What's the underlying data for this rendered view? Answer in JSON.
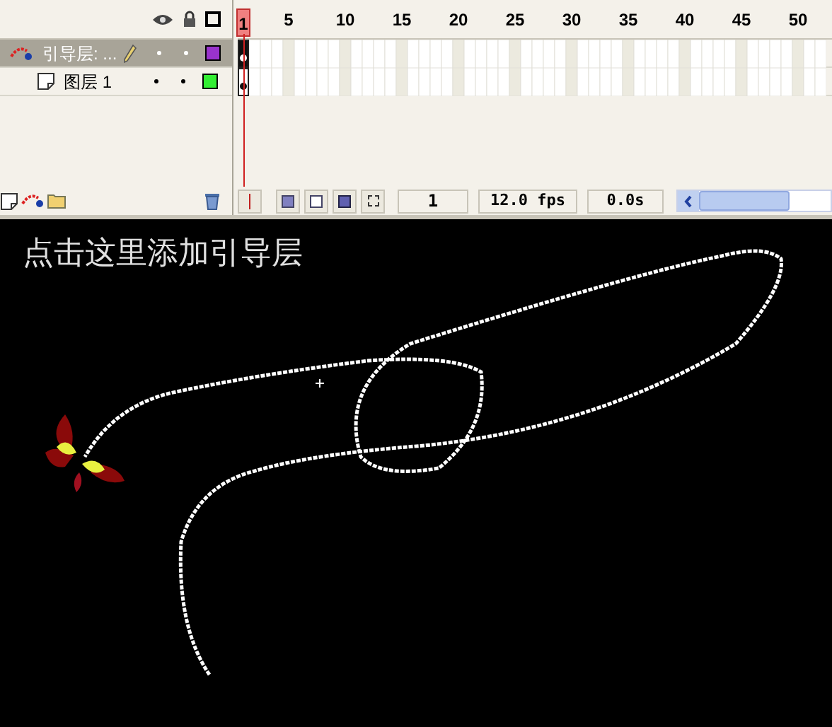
{
  "ruler": {
    "labels": [
      "1",
      "5",
      "10",
      "15",
      "20",
      "25",
      "30",
      "35",
      "40",
      "45",
      "50"
    ]
  },
  "layers": [
    {
      "name": "引导层: ...",
      "kind": "guide",
      "selected": true,
      "editing": true,
      "color": "#9933cc",
      "children": [
        {
          "name": "图层 1",
          "kind": "normal",
          "selected": false,
          "editing": false,
          "color": "#33ee33"
        }
      ]
    }
  ],
  "status": {
    "frame": "1",
    "fps": "12.0 fps",
    "time": "0.0s"
  },
  "stage": {
    "caption": "点击这里添加引导层"
  }
}
